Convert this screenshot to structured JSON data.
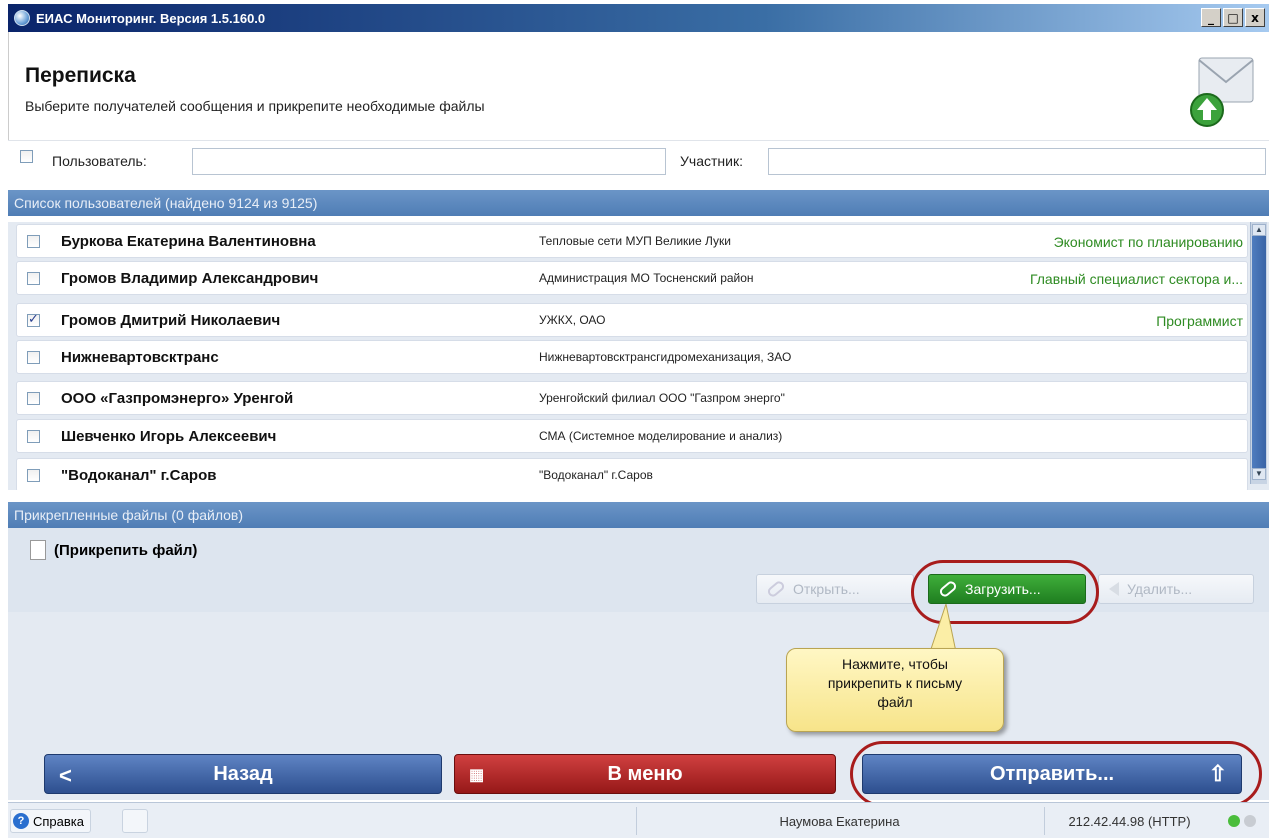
{
  "window": {
    "title": "ЕИАС Мониторинг. Версия 1.5.160.0",
    "minimize": "_",
    "maximize": "□",
    "close": "x"
  },
  "header": {
    "title": "Переписка",
    "subtitle": "Выберите получателей сообщения и прикрепите необходимые файлы"
  },
  "filter": {
    "user_label": "Пользователь:",
    "user_value": "",
    "participant_label": "Участник:",
    "participant_value": ""
  },
  "users_section": {
    "title": "Список пользователей (найдено 9124 из 9125)"
  },
  "users": [
    {
      "name": "Буркова Екатерина Валентиновна",
      "org": "Тепловые сети МУП Великие Луки",
      "position": "Экономист по планированию",
      "checked": false
    },
    {
      "name": "Громов Владимир Александрович",
      "org": "Администрация МО Тосненский район",
      "position": "Главный специалист сектора и...",
      "checked": false
    },
    {
      "name": "Громов Дмитрий Николаевич",
      "org": "УЖКХ, ОАО",
      "position": "Программист",
      "checked": true
    },
    {
      "name": "Нижневартовсктранс",
      "org": "Нижневартовсктрансгидромеханизация, ЗАО",
      "position": "",
      "checked": false
    },
    {
      "name": "ООО «Газпромэнерго» Уренгой",
      "org": "Уренгойский филиал ООО \"Газпром энерго\"",
      "position": "",
      "checked": false
    },
    {
      "name": "Шевченко Игорь Алексеевич",
      "org": "СМА (Системное моделирование и анализ)",
      "position": "",
      "checked": false
    },
    {
      "name": "\"Водоканал\" г.Саров",
      "org": "\"Водоканал\" г.Саров",
      "position": "",
      "checked": false
    }
  ],
  "files_section": {
    "title": "Прикрепленные файлы (0 файлов)",
    "attach_label": "(Прикрепить файл)"
  },
  "file_buttons": {
    "open": "Открыть...",
    "upload": "Загрузить...",
    "delete": "Удалить..."
  },
  "callout": {
    "line1": "Нажмите, чтобы",
    "line2": "прикрепить к письму",
    "line3": "файл"
  },
  "bottom": {
    "back": "Назад",
    "menu": "В меню",
    "send": "Отправить..."
  },
  "status": {
    "help": "Справка",
    "user": "Наумова Екатерина",
    "server": "212.42.44.98 (HTTP)"
  },
  "colors": {
    "accent_blue": "#4f7db5",
    "position_green": "#2e8b22",
    "upload_green": "#2a962a",
    "menu_red": "#b02828",
    "highlight_red": "#a81c1c"
  }
}
